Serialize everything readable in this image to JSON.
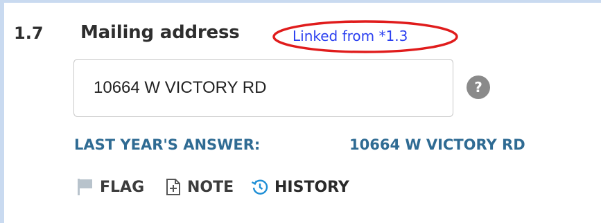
{
  "question": {
    "number": "1.7",
    "title": "Mailing address",
    "linked_text": "Linked from *1.3"
  },
  "field": {
    "value": "10664 W VICTORY RD"
  },
  "help": {
    "glyph": "?"
  },
  "last_year": {
    "label": "LAST YEAR'S ANSWER:",
    "value": "10664 W VICTORY RD"
  },
  "actions": {
    "flag": "FLAG",
    "note": "NOTE",
    "history": "HISTORY"
  },
  "colors": {
    "panel_border": "#c9daf0",
    "link": "#2a3ff0",
    "highlight_circle": "#e01c1c",
    "last_year_text": "#2f6b93",
    "flag_icon": "#b8c3cc",
    "history_icon": "#1f8fd6"
  },
  "icons": {
    "flag": "flag-icon",
    "note": "note-plus-icon",
    "history": "history-clock-icon",
    "help": "help-circle-icon"
  }
}
